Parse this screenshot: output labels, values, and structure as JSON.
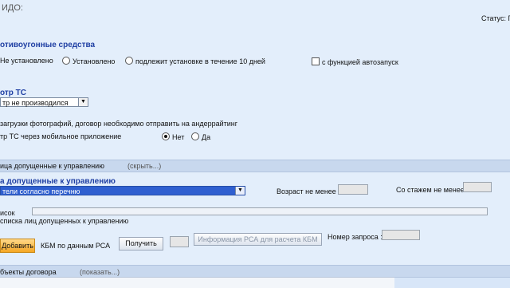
{
  "header": {
    "title": "ИДО:",
    "status_label": "Статус:",
    "status_value": "Г"
  },
  "antitheft": {
    "title": "отивоугонные средства",
    "options": [
      "Не установлено",
      "Установлено",
      "подлежит установке в течение 10 дней"
    ],
    "autostart_label": "с функцией автозапуск"
  },
  "inspection": {
    "title": "отр ТС",
    "select_value": "тр не производился",
    "upload_note": "загрузки фотографий, договор необходимо отправить на андеррайтинг",
    "mobile_label": "тр ТС через мобильное приложение",
    "options": [
      "Нет",
      "Да"
    ]
  },
  "drivers_bar": {
    "label": "ица допущенные к управлению",
    "toggle": "(скрыть...)"
  },
  "drivers": {
    "title": "а допущенные к управлению",
    "select_value": "тели согласно перечню",
    "age_label": "Возраст не менее",
    "experience_label": "Со стажем не менее",
    "list_label": "исок",
    "list_sub_label": "списка лиц допущенных к управлению"
  },
  "actions": {
    "add": "Добавить",
    "kbm_label": "КБМ по данным РСА",
    "get": "Получить",
    "rsa_info": "Информация РСА для расчета КБМ",
    "request_label": "Номер запроса :"
  },
  "objects_bar": {
    "label": "бъекты договора",
    "toggle": "(показать...)"
  },
  "footer": {
    "partial": "(...)"
  },
  "colors": {
    "title_blue": "#1f3fa3",
    "select_highlight": "#2f5fd0",
    "button_orange": "#f5a623"
  }
}
